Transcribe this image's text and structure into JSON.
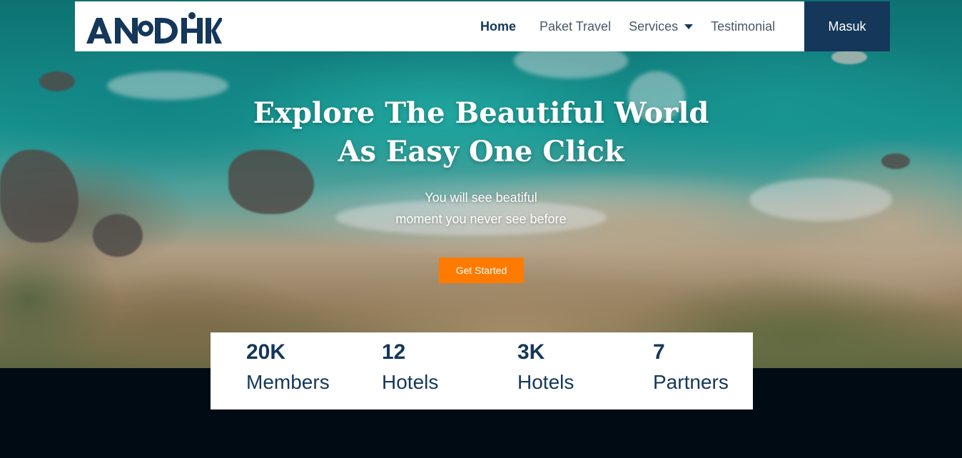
{
  "brand": {
    "logo_text": "ANDHK",
    "color": "#14375a"
  },
  "nav": {
    "items": [
      {
        "label": "Home",
        "active": true
      },
      {
        "label": "Paket Travel",
        "active": false
      },
      {
        "label": "Services",
        "active": false,
        "dropdown": true
      },
      {
        "label": "Testimonial",
        "active": false
      }
    ],
    "login_label": "Masuk"
  },
  "hero": {
    "title_line1": "Explore The Beautiful World",
    "title_line2": "As Easy One Click",
    "subtitle_line1": "You will see beatiful",
    "subtitle_line2": "moment you never see before",
    "cta_label": "Get Started"
  },
  "stats": [
    {
      "value": "20K",
      "label": "Members"
    },
    {
      "value": "12",
      "label": "Hotels"
    },
    {
      "value": "3K",
      "label": "Hotels"
    },
    {
      "value": "7",
      "label": "Partners"
    }
  ],
  "colors": {
    "primary": "#14375a",
    "accent": "#ff7b00",
    "footer_bg": "#010b14"
  },
  "icons": {
    "dropdown": "caret-down-icon"
  }
}
